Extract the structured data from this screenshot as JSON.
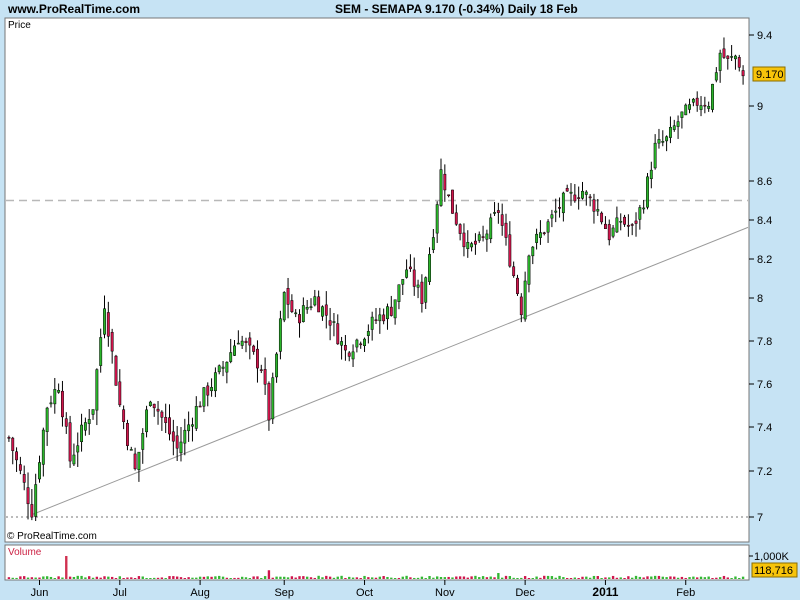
{
  "header": {
    "site": "www.ProRealTime.com",
    "title": "SEM - SEMAPA    9.170 (-0.34%)    Daily  18 Feb"
  },
  "price_panel": {
    "label": "Price",
    "last_price": "9.170",
    "copyright": "© ProRealTime.com"
  },
  "volume_panel": {
    "label": "Volume",
    "scale_label": "1,000K",
    "last_volume": "118,716"
  },
  "colors": {
    "up": "#2ab52a",
    "down": "#d0154c",
    "wick": "#000000",
    "trendline": "#9a9a9a",
    "volume": "#33b833",
    "volume_spike": "#d03050",
    "label_text": "#cc2244",
    "price_badge": "#f7c40a"
  },
  "chart_data": [
    {
      "type": "candlestick",
      "title": "SEM - SEMAPA",
      "period": "Daily",
      "last": 9.17,
      "change_pct": -0.34,
      "ylim": [
        6.95,
        9.5
      ],
      "y_ticks": [
        7,
        7.2,
        7.4,
        7.6,
        7.8,
        8,
        8.2,
        8.4,
        8.6,
        9,
        9.4
      ],
      "x_ticks": [
        {
          "label": "Jun",
          "index": 8
        },
        {
          "label": "Jul",
          "index": 29
        },
        {
          "label": "Aug",
          "index": 50
        },
        {
          "label": "Sep",
          "index": 72
        },
        {
          "label": "Oct",
          "index": 93
        },
        {
          "label": "Nov",
          "index": 114
        },
        {
          "label": "Dec",
          "index": 135
        },
        {
          "label": "2011",
          "index": 156,
          "bold": true
        },
        {
          "label": "Feb",
          "index": 177
        }
      ],
      "horizontal_lines": [
        {
          "value": 8.5,
          "style": "dashed"
        },
        {
          "value": 7.0,
          "style": "dotted"
        }
      ],
      "trendline": {
        "from": {
          "index": 6,
          "value": 7.01
        },
        "to": {
          "index": 193,
          "value": 8.36
        }
      },
      "anchors": [
        [
          0,
          7.35
        ],
        [
          6,
          7.03
        ],
        [
          10,
          7.5
        ],
        [
          13,
          7.6
        ],
        [
          16,
          7.25
        ],
        [
          22,
          7.5
        ],
        [
          25,
          7.98
        ],
        [
          29,
          7.5
        ],
        [
          33,
          7.2
        ],
        [
          37,
          7.55
        ],
        [
          44,
          7.3
        ],
        [
          50,
          7.52
        ],
        [
          56,
          7.68
        ],
        [
          60,
          7.82
        ],
        [
          66,
          7.68
        ],
        [
          68,
          7.45
        ],
        [
          72,
          8.02
        ],
        [
          75,
          7.9
        ],
        [
          80,
          8.0
        ],
        [
          84,
          7.9
        ],
        [
          88,
          7.75
        ],
        [
          92,
          7.82
        ],
        [
          96,
          7.9
        ],
        [
          100,
          7.95
        ],
        [
          104,
          8.15
        ],
        [
          108,
          8.0
        ],
        [
          111,
          8.35
        ],
        [
          113,
          8.65
        ],
        [
          116,
          8.45
        ],
        [
          120,
          8.25
        ],
        [
          124,
          8.3
        ],
        [
          128,
          8.45
        ],
        [
          131,
          8.2
        ],
        [
          134,
          7.95
        ],
        [
          136,
          8.25
        ],
        [
          140,
          8.35
        ],
        [
          145,
          8.5
        ],
        [
          150,
          8.55
        ],
        [
          154,
          8.45
        ],
        [
          157,
          8.32
        ],
        [
          160,
          8.4
        ],
        [
          163,
          8.35
        ],
        [
          166,
          8.5
        ],
        [
          169,
          8.78
        ],
        [
          172,
          8.82
        ],
        [
          176,
          8.95
        ],
        [
          180,
          9.02
        ],
        [
          183,
          9.02
        ],
        [
          186,
          9.3
        ],
        [
          188,
          9.25
        ],
        [
          190,
          9.28
        ],
        [
          192,
          9.2
        ]
      ],
      "candle_count": 193
    },
    {
      "type": "bar",
      "title": "Volume",
      "series": [
        {
          "name": "Volume",
          "spikes": [
            {
              "index": 15,
              "value": 1000000
            },
            {
              "index": 68,
              "value": 380000
            },
            {
              "index": 128,
              "value": 260000
            }
          ]
        }
      ],
      "last_value": 118716,
      "ylim": [
        0,
        1000000
      ]
    }
  ]
}
